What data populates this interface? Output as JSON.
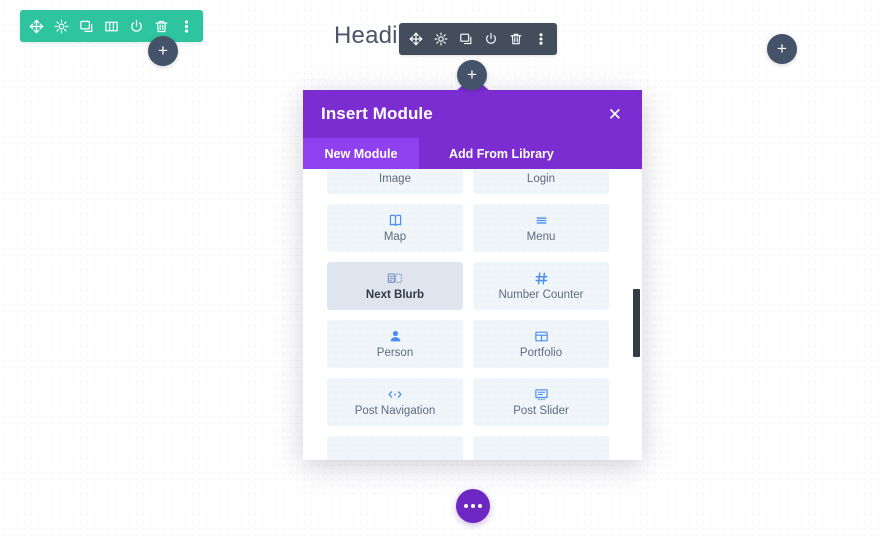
{
  "canvas": {
    "heading_text": "Heading",
    "section_toolbar": {
      "name": "section-settings-toolbar",
      "color": "#2ec4a0",
      "buttons": [
        {
          "name": "move-icon",
          "title": "Move Section"
        },
        {
          "name": "gear-icon",
          "title": "Section Settings"
        },
        {
          "name": "duplicate-icon",
          "title": "Duplicate Section"
        },
        {
          "name": "columns-icon",
          "title": "Change Column Structure"
        },
        {
          "name": "power-icon",
          "title": "Disable Section"
        },
        {
          "name": "trash-icon",
          "title": "Delete Section"
        },
        {
          "name": "dots-vertical-icon",
          "title": "More Options"
        }
      ]
    },
    "module_toolbar": {
      "name": "module-settings-toolbar",
      "color": "#434d5c",
      "buttons": [
        {
          "name": "move-icon",
          "title": "Move Module"
        },
        {
          "name": "gear-icon",
          "title": "Module Settings"
        },
        {
          "name": "duplicate-icon",
          "title": "Duplicate Module"
        },
        {
          "name": "power-icon",
          "title": "Disable Module"
        },
        {
          "name": "trash-icon",
          "title": "Delete Module"
        },
        {
          "name": "dots-vertical-icon",
          "title": "More Options"
        }
      ]
    },
    "add_buttons": [
      {
        "name": "add-row-button-left",
        "label": "+"
      },
      {
        "name": "add-section-button-right",
        "label": "+"
      },
      {
        "name": "add-module-button-center",
        "label": "+"
      }
    ],
    "page_settings_label": "•••"
  },
  "modal": {
    "title": "Insert Module",
    "close_label": "✕",
    "header_color": "#7b2dd1",
    "active_tab_color": "#9041ef",
    "tabs": [
      {
        "label": "New Module",
        "active": true
      },
      {
        "label": "Add From Library",
        "active": false
      }
    ],
    "modules": [
      {
        "label": "Image",
        "icon": "image-icon",
        "hovered": false
      },
      {
        "label": "Login",
        "icon": "lock-icon",
        "hovered": false
      },
      {
        "label": "Map",
        "icon": "map-icon",
        "hovered": false
      },
      {
        "label": "Menu",
        "icon": "menu-icon",
        "hovered": false
      },
      {
        "label": "Next Blurb",
        "icon": "next-blurb-icon",
        "hovered": true
      },
      {
        "label": "Number Counter",
        "icon": "hash-icon",
        "hovered": false
      },
      {
        "label": "Person",
        "icon": "person-icon",
        "hovered": false
      },
      {
        "label": "Portfolio",
        "icon": "portfolio-grid-icon",
        "hovered": false
      },
      {
        "label": "Post Navigation",
        "icon": "post-navigation-icon",
        "hovered": false
      },
      {
        "label": "Post Slider",
        "icon": "post-slider-icon",
        "hovered": false
      },
      {
        "label": "",
        "icon": "",
        "hovered": false
      },
      {
        "label": "",
        "icon": "",
        "hovered": false
      }
    ]
  }
}
